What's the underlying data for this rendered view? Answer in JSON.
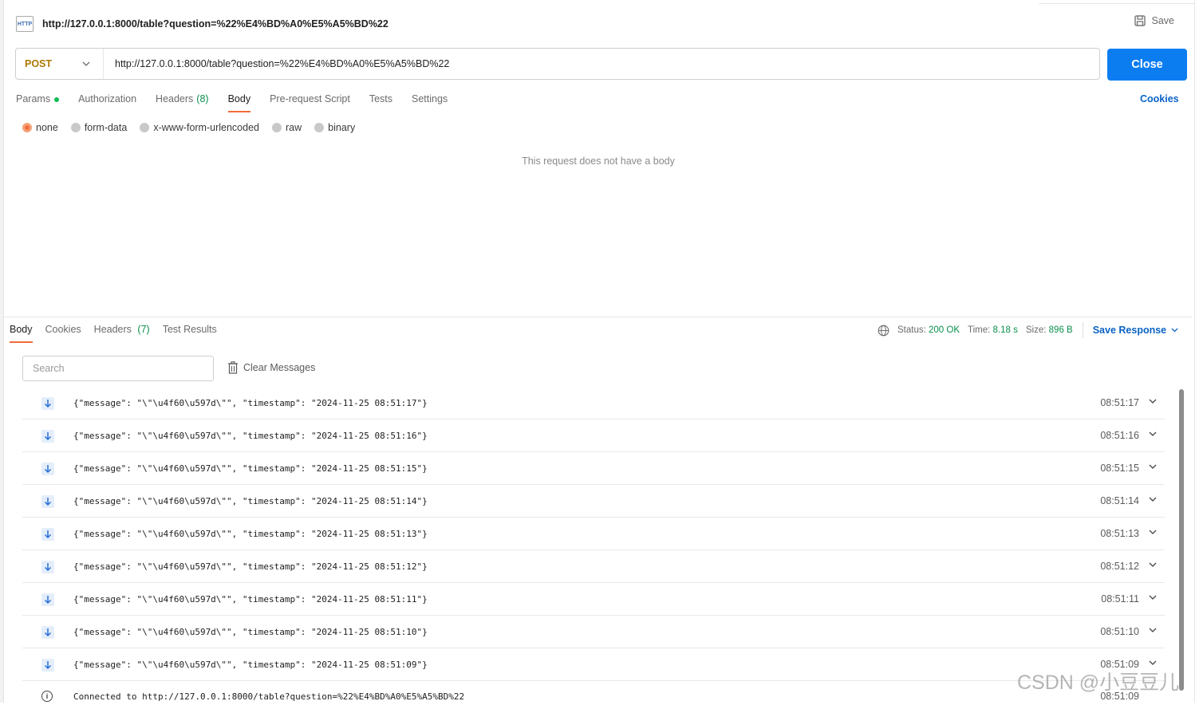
{
  "header": {
    "tab_icon": "HTTP",
    "tab_title": "http://127.0.0.1:8000/table?question=%22%E4%BD%A0%E5%A5%BD%22",
    "save_label": "Save"
  },
  "request": {
    "method": "POST",
    "url": "http://127.0.0.1:8000/table?question=%22%E4%BD%A0%E5%A5%BD%22",
    "close_label": "Close",
    "tabs": [
      {
        "label": "Params",
        "extra": ""
      },
      {
        "label": "Authorization",
        "extra": ""
      },
      {
        "label": "Headers",
        "extra": "(8)"
      },
      {
        "label": "Body",
        "extra": ""
      },
      {
        "label": "Pre-request Script",
        "extra": ""
      },
      {
        "label": "Tests",
        "extra": ""
      },
      {
        "label": "Settings",
        "extra": ""
      }
    ],
    "active_tab": "Body",
    "cookies_label": "Cookies",
    "body_types": [
      "none",
      "form-data",
      "x-www-form-urlencoded",
      "raw",
      "binary"
    ],
    "selected_body_type": "none",
    "no_body_text": "This request does not have a body"
  },
  "response": {
    "tabs": [
      {
        "label": "Body",
        "extra": ""
      },
      {
        "label": "Cookies",
        "extra": ""
      },
      {
        "label": "Headers",
        "extra": "(7)"
      },
      {
        "label": "Test Results",
        "extra": ""
      }
    ],
    "active_tab": "Body",
    "status_label": "Status:",
    "status_value": "200 OK",
    "time_label": "Time:",
    "time_value": "8.18 s",
    "size_label": "Size:",
    "size_value": "896 B",
    "save_response_label": "Save Response",
    "search_placeholder": "Search",
    "clear_messages_label": "Clear Messages",
    "messages": [
      {
        "text": "{\"message\": \"\\\"\\u4f60\\u597d\\\"\", \"timestamp\": \"2024-11-25 08:51:17\"}",
        "time": "08:51:17"
      },
      {
        "text": "{\"message\": \"\\\"\\u4f60\\u597d\\\"\", \"timestamp\": \"2024-11-25 08:51:16\"}",
        "time": "08:51:16"
      },
      {
        "text": "{\"message\": \"\\\"\\u4f60\\u597d\\\"\", \"timestamp\": \"2024-11-25 08:51:15\"}",
        "time": "08:51:15"
      },
      {
        "text": "{\"message\": \"\\\"\\u4f60\\u597d\\\"\", \"timestamp\": \"2024-11-25 08:51:14\"}",
        "time": "08:51:14"
      },
      {
        "text": "{\"message\": \"\\\"\\u4f60\\u597d\\\"\", \"timestamp\": \"2024-11-25 08:51:13\"}",
        "time": "08:51:13"
      },
      {
        "text": "{\"message\": \"\\\"\\u4f60\\u597d\\\"\", \"timestamp\": \"2024-11-25 08:51:12\"}",
        "time": "08:51:12"
      },
      {
        "text": "{\"message\": \"\\\"\\u4f60\\u597d\\\"\", \"timestamp\": \"2024-11-25 08:51:11\"}",
        "time": "08:51:11"
      },
      {
        "text": "{\"message\": \"\\\"\\u4f60\\u597d\\\"\", \"timestamp\": \"2024-11-25 08:51:10\"}",
        "time": "08:51:10"
      },
      {
        "text": "{\"message\": \"\\\"\\u4f60\\u597d\\\"\", \"timestamp\": \"2024-11-25 08:51:09\"}",
        "time": "08:51:09"
      }
    ],
    "connection": {
      "text": "Connected to http://127.0.0.1:8000/table?question=%22%E4%BD%A0%E5%A5%BD%22",
      "time": "08:51:09"
    }
  },
  "watermark": "CSDN @小豆豆儿",
  "colors": {
    "accent": "#0b7df1",
    "method": "#ad7a03",
    "success": "#0a8f4c",
    "active_tab": "#f26b3a",
    "link": "#0b63c5"
  },
  "icons": [
    "http-icon",
    "save-icon",
    "chevron-down-icon",
    "globe-icon",
    "trash-icon",
    "arrow-down-icon",
    "info-icon"
  ]
}
